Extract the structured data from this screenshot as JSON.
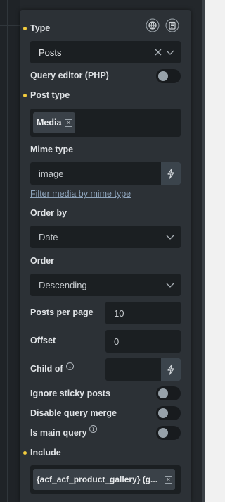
{
  "query": {
    "type": {
      "label": "Type",
      "value": "Posts"
    },
    "query_editor": {
      "label": "Query editor (PHP)",
      "enabled": false
    },
    "post_type": {
      "label": "Post type",
      "tags": [
        "Media"
      ]
    },
    "mime_type": {
      "label": "Mime type",
      "value": "image",
      "link": "Filter media by mime type"
    },
    "order_by": {
      "label": "Order by",
      "value": "Date"
    },
    "order": {
      "label": "Order",
      "value": "Descending"
    },
    "posts_per_page": {
      "label": "Posts per page",
      "value": "10"
    },
    "offset": {
      "label": "Offset",
      "value": "0"
    },
    "child_of": {
      "label": "Child of",
      "value": ""
    },
    "ignore_sticky": {
      "label": "Ignore sticky posts",
      "enabled": false
    },
    "disable_merge": {
      "label": "Disable query merge",
      "enabled": false
    },
    "is_main_query": {
      "label": "Is main query",
      "enabled": false
    },
    "include": {
      "label": "Include",
      "tags": [
        "{acf_acf_product_gallery} (g..."
      ]
    }
  },
  "colors": {
    "panel": "#2c3136",
    "field": "#1b1f22",
    "accent_dot": "#f2cc3d",
    "link": "#8ea4bb"
  },
  "icons": [
    "globe-icon",
    "clipboard-icon",
    "clear-x-icon",
    "chevron-down-icon",
    "bolt-icon",
    "info-icon"
  ]
}
